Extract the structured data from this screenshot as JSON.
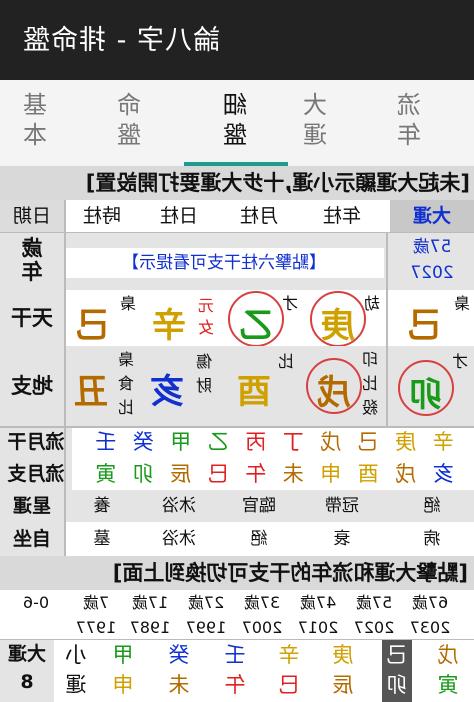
{
  "header": {
    "title": "論八字 - 排命盤"
  },
  "tabs": [
    {
      "label": "基本",
      "l1": "基",
      "l2": "本"
    },
    {
      "label": "命盤",
      "l1": "命",
      "l2": "盤"
    },
    {
      "label": "細盤",
      "l1": "細",
      "l2": "盤"
    },
    {
      "label": "大運",
      "l1": "大",
      "l2": "運"
    },
    {
      "label": "流年",
      "l1": "流",
      "l2": "年"
    }
  ],
  "banner_top": "[未起大運顯示小運,十步大運要打開設置]",
  "columns": {
    "label": "日期",
    "hour": "時柱",
    "day": "日柱",
    "month": "月柱",
    "year": "年柱",
    "dayun": "大運"
  },
  "age_row": {
    "label_1": "歲",
    "label_2": "年",
    "hint": "【點擊六柱干支可看提示】",
    "dayun_age": "57歲",
    "dayun_year": "2027"
  },
  "stems_row": {
    "label": "天干",
    "hour": {
      "char": "己",
      "god": "梟"
    },
    "day": {
      "char": "辛",
      "god_1": "元",
      "god_2": "女"
    },
    "month": {
      "char": "乙",
      "god": "才"
    },
    "year": {
      "char": "庚",
      "god": "劫"
    },
    "dayun": {
      "char": "己",
      "god": "梟"
    }
  },
  "branches_row": {
    "label": "地支",
    "hour": {
      "char": "丑",
      "hidden": [
        "梟",
        "食",
        "比"
      ]
    },
    "day": {
      "char": "亥",
      "hidden": [
        "傷",
        "財"
      ]
    },
    "month": {
      "char": "酉",
      "hidden": [
        "比"
      ]
    },
    "year": {
      "char": "戌",
      "hidden": [
        "印",
        "比",
        "殺"
      ]
    },
    "dayun": {
      "char": "卯",
      "hidden": [
        "才"
      ]
    }
  },
  "flow_month_stem": {
    "label": "流月干",
    "chars": [
      "壬",
      "癸",
      "甲",
      "乙",
      "丙",
      "丁",
      "戊",
      "己",
      "庚",
      "辛"
    ]
  },
  "flow_month_branch": {
    "label": "流月支",
    "chars": [
      "寅",
      "卯",
      "辰",
      "巳",
      "午",
      "未",
      "申",
      "酉",
      "戌",
      "亥"
    ]
  },
  "star_row": {
    "label": "星運",
    "values": {
      "hour": "養",
      "day": "沐浴",
      "month": "臨官",
      "year": "冠帶",
      "dayun": "絕"
    }
  },
  "self_row": {
    "label": "自坐",
    "values": {
      "hour": "墓",
      "day": "沐浴",
      "month": "絕",
      "year": "衰",
      "dayun": "病"
    }
  },
  "banner_bottom": "[點擊大運和流年的干支可切換到上面]",
  "ages": [
    "0-6",
    "7歲",
    "17歲",
    "27歲",
    "37歲",
    "47歲",
    "57歲",
    "67歲"
  ],
  "years": [
    "1977",
    "1987",
    "1997",
    "2007",
    "2017",
    "2027",
    "2037"
  ],
  "dayun_list": {
    "label": "大運",
    "index": "8",
    "small": {
      "top": "小",
      "bottom": "運"
    },
    "pillars": [
      {
        "stem": "甲",
        "branch": "申"
      },
      {
        "stem": "癸",
        "branch": "未"
      },
      {
        "stem": "壬",
        "branch": "午"
      },
      {
        "stem": "辛",
        "branch": "巳"
      },
      {
        "stem": "庚",
        "branch": "辰"
      },
      {
        "stem": "己",
        "branch": "卯"
      },
      {
        "stem": "戊",
        "branch": "寅"
      }
    ]
  },
  "colors": {
    "wood": "#1a9a1a",
    "fire": "#e02020",
    "earth": "#b36b00",
    "metal": "#d0a000",
    "water": "#1030d0",
    "accent": "#1e9a8e",
    "circle": "#d84040"
  }
}
